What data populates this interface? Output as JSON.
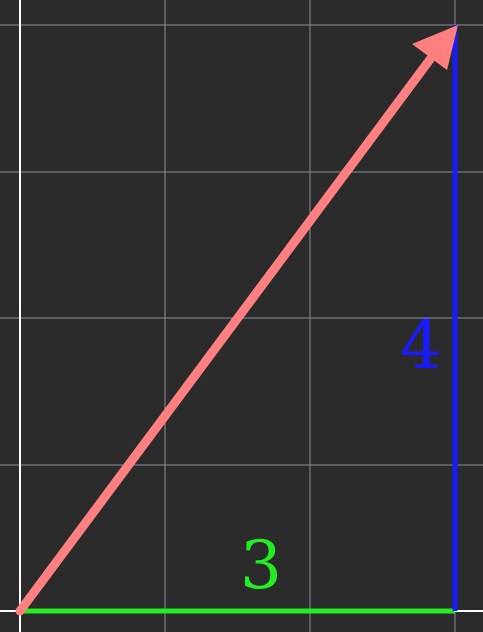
{
  "diagram": {
    "labels": {
      "horizontal_side": "3",
      "vertical_side": "4"
    },
    "colors": {
      "background": "#2b2b2b",
      "grid": "#8a9299",
      "axis": "#ffffff",
      "horizontal_side": "#22ee22",
      "vertical_side": "#1a1aff",
      "hypotenuse_arrow": "#ff8080"
    }
  }
}
